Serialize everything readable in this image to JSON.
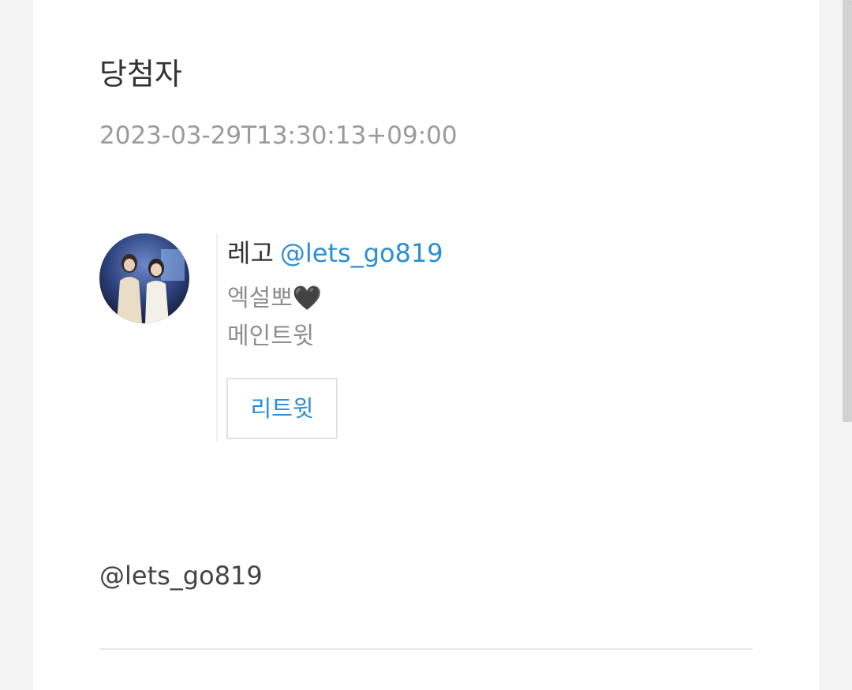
{
  "post": {
    "title": "당첨자",
    "timestamp": "2023-03-29T13:30:13+09:00"
  },
  "tweet": {
    "author_name": "레고",
    "author_handle": "@lets_go819",
    "line1": "엑설뽀🖤",
    "line2": "메인트윗",
    "retweet_label": "리트윗"
  },
  "mention": "@lets_go819",
  "icons": {
    "avatar": "profile-photo"
  },
  "colors": {
    "link": "#2b8ed6",
    "text": "#333333",
    "muted": "#9a9a9a"
  }
}
